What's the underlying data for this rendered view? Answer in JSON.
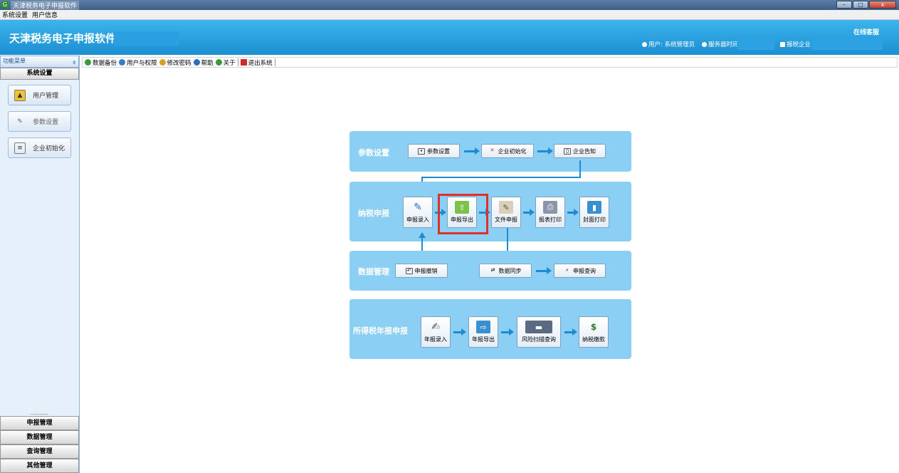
{
  "window": {
    "title": "天津税务电子申报软件",
    "buttons": [
      "–",
      "□",
      "x"
    ]
  },
  "menubar": {
    "items": [
      "系统设置",
      "用户信息"
    ]
  },
  "header": {
    "app_name": "天津税务电子申报软件",
    "online_service": "在线客服",
    "user": "用户: 系统管理员",
    "server_time": "服务器时间",
    "company": "报税企业"
  },
  "sidebar": {
    "title": "功能菜单",
    "pin": "ª",
    "group": "系统设置",
    "items": [
      {
        "label": "用户管理",
        "icon": "user-card-icon"
      },
      {
        "label": "参数设置",
        "icon": "wrench-icon"
      },
      {
        "label": "企业初始化",
        "icon": "clipboard-icon"
      }
    ],
    "dots": "..........",
    "bottom_groups": [
      "申报管理",
      "数据管理",
      "查询管理",
      "其他管理"
    ]
  },
  "toolbar": {
    "items": [
      {
        "label": "数据备份",
        "icon": "backup-icon",
        "color": "#3a9a3a"
      },
      {
        "label": "用户与权限",
        "icon": "user-icon",
        "color": "#3a78c8"
      },
      {
        "label": "修改密码",
        "icon": "key-icon",
        "color": "#d8a020"
      },
      {
        "label": "帮助",
        "icon": "help-icon",
        "color": "#2a6cc4"
      },
      {
        "label": "关于",
        "icon": "tag-icon",
        "color": "#3a9a3a"
      },
      {
        "label": "退出系统",
        "icon": "exit-icon",
        "color": "#d02a2a"
      }
    ]
  },
  "flow": {
    "param_panel": {
      "label": "参数设置",
      "buttons": [
        "参数设置",
        "企业初始化",
        "企业告知"
      ]
    },
    "tax_panel": {
      "label": "纳税申报",
      "buttons": [
        "申报录入",
        "申报导出",
        "文件申报",
        "报表打印",
        "封面打印"
      ]
    },
    "data_panel": {
      "label": "数据管理",
      "buttons": [
        "申报撤销",
        "数据同步",
        "申报查询"
      ]
    },
    "income_panel": {
      "label": "所得税年报申报",
      "buttons": [
        "年报录入",
        "年报导出",
        "风险扫描查询",
        "纳税缴款"
      ]
    }
  },
  "colors": {
    "header": "#1b8fd2",
    "panel": "#8bcff4",
    "arrow": "#1d8bd1",
    "highlight": "#e0302a"
  }
}
